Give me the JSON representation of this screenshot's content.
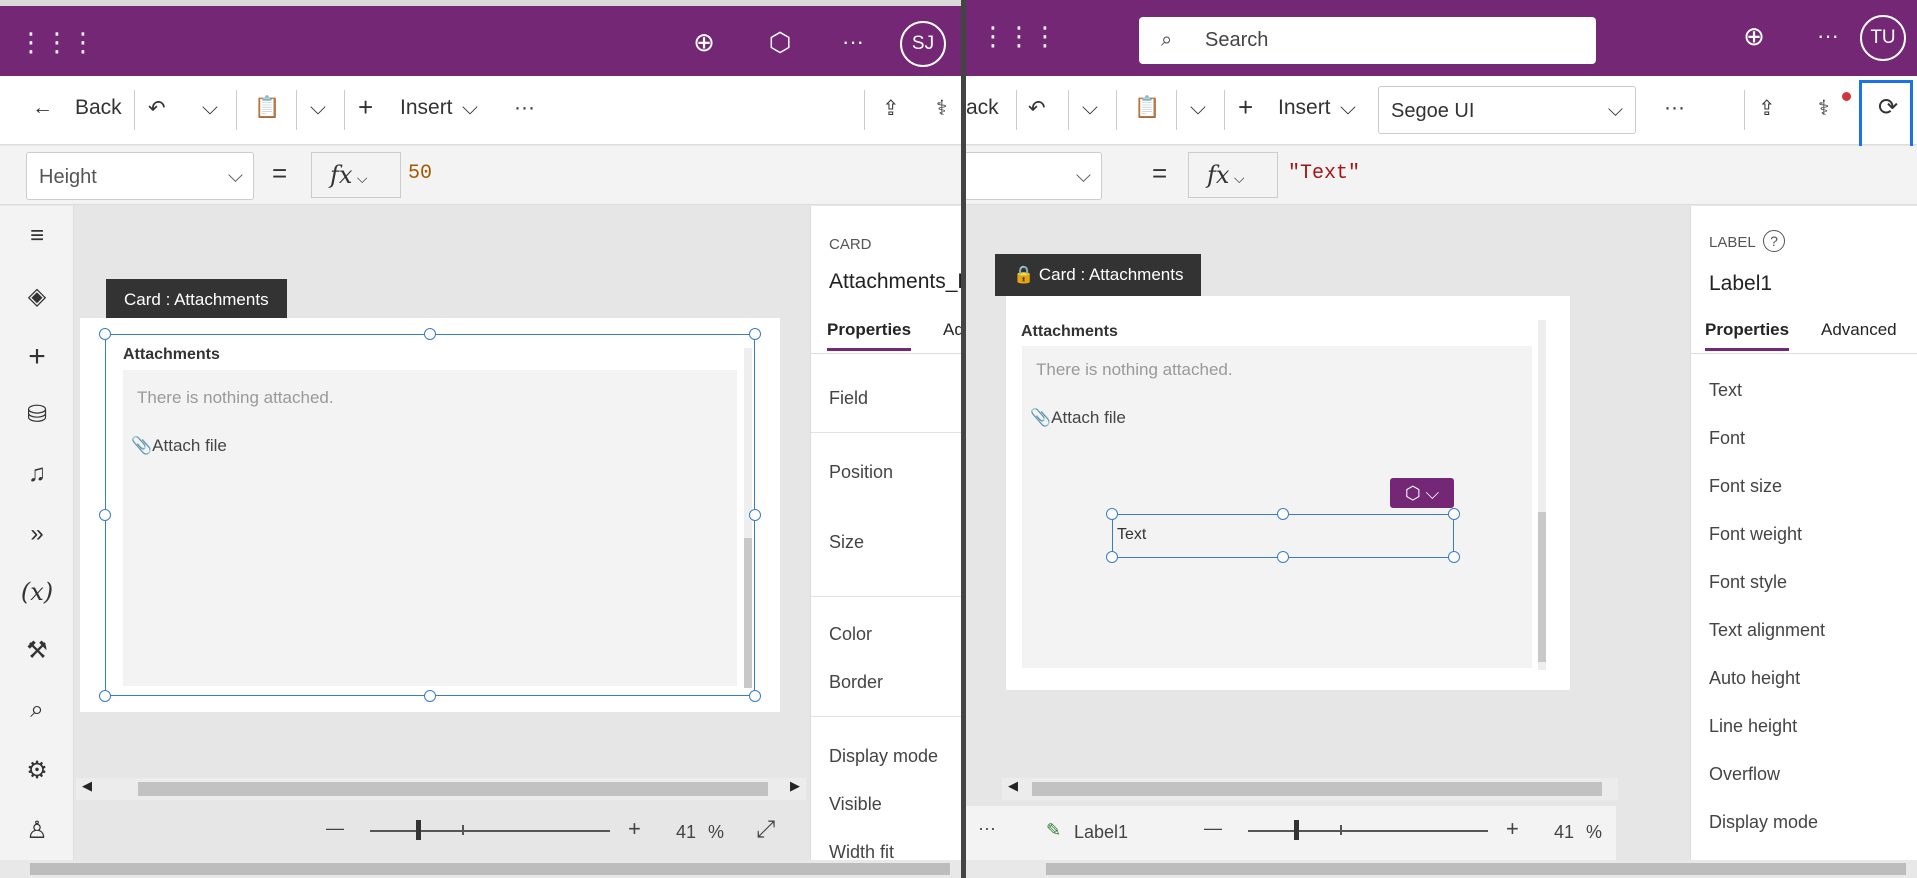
{
  "left": {
    "avatar": "SJ",
    "toolbar": {
      "back": "Back",
      "insert": "Insert",
      "more": "···"
    },
    "formula": {
      "property": "Height",
      "fx": "fx",
      "value": "50"
    },
    "tooltip": "Card : Attachments",
    "card": {
      "title": "Attachments",
      "nothing": "There is nothing attached.",
      "attach": "Attach file"
    },
    "panel": {
      "heading": "CARD",
      "name": "Attachments_D",
      "tab_properties": "Properties",
      "tab_advanced": "Ad",
      "items": [
        "Field",
        "Position",
        "Size",
        "Color",
        "Border",
        "Display mode",
        "Visible",
        "Width fit"
      ]
    },
    "zoom": {
      "value": "41",
      "unit": "%"
    }
  },
  "right": {
    "avatar": "TU",
    "search_placeholder": "Search",
    "toolbar": {
      "back": "ack",
      "insert": "Insert",
      "font": "Segoe UI",
      "more": "···"
    },
    "formula": {
      "fx": "fx",
      "value": "\"Text\""
    },
    "tooltip": "Card : Attachments",
    "card": {
      "title": "Attachments",
      "nothing": "There is nothing attached.",
      "attach": "Attach file",
      "label_text": "Text"
    },
    "panel": {
      "heading": "LABEL",
      "name": "Label1",
      "tab_properties": "Properties",
      "tab_advanced": "Advanced",
      "items": [
        "Text",
        "Font",
        "Font size",
        "Font weight",
        "Font style",
        "Text alignment",
        "Auto height",
        "Line height",
        "Overflow",
        "Display mode"
      ]
    },
    "status": {
      "more": "···",
      "selected": "Label1"
    },
    "zoom": {
      "value": "41",
      "unit": "%"
    }
  },
  "colors": {
    "brand": "#742774",
    "selection": "#3a7cc4",
    "highlight": "#1a73e8"
  }
}
